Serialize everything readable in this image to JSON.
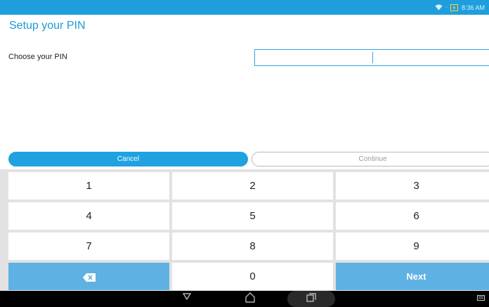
{
  "status_bar": {
    "time": "8:36 AM",
    "icons": [
      "wifi-icon",
      "battery-charging-icon"
    ]
  },
  "page": {
    "title": "Setup your PIN",
    "field_label": "Choose your PIN",
    "pin_value": ""
  },
  "buttons": {
    "cancel": "Cancel",
    "continue": "Continue"
  },
  "keypad": {
    "keys": [
      "1",
      "2",
      "3",
      "4",
      "5",
      "6",
      "7",
      "8",
      "9",
      "",
      "0",
      "Next"
    ],
    "backspace_icon": "backspace-icon"
  },
  "nav_bar": {
    "icons": [
      "back-icon",
      "home-icon",
      "recents-icon",
      "keyboard-icon"
    ]
  },
  "colors": {
    "accent": "#1e9fdc",
    "key_blue": "#5eb1e3"
  }
}
